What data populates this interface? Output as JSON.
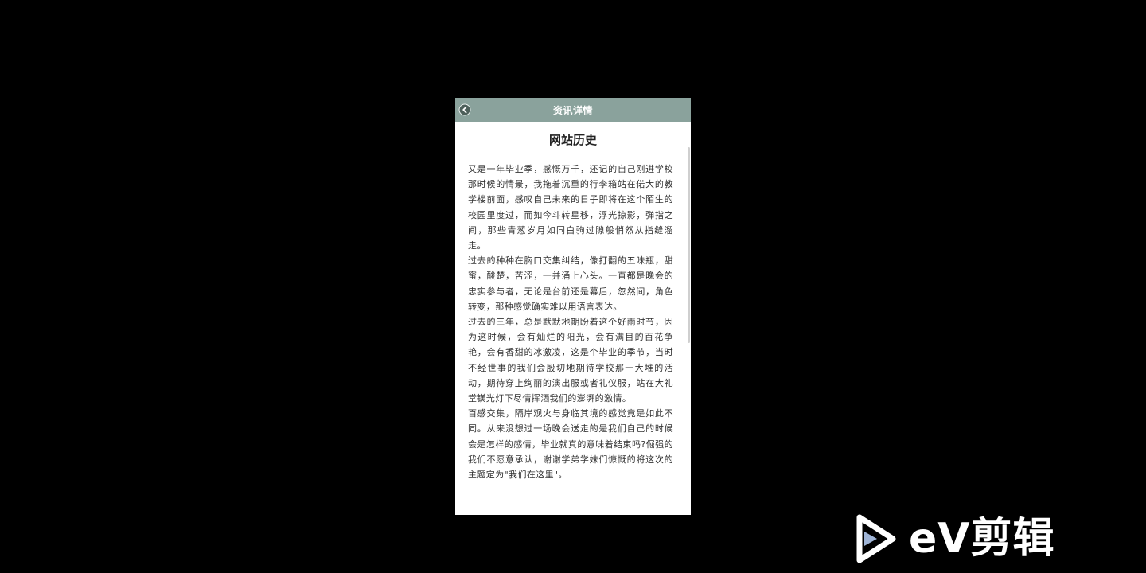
{
  "header": {
    "title": "资讯详情",
    "back_icon": "back-arrow-icon"
  },
  "article": {
    "title": "网站历史",
    "paragraphs": [
      "又是一年毕业季，感慨万千，还记的自己刚进学校那时候的情景，我拖着沉重的行李箱站在偌大的教学楼前面，感叹自己未来的日子即将在这个陌生的校园里度过，而如今斗转星移，浮光掠影，弹指之间，那些青葱岁月如同白驹过隙般悄然从指缝溜走。",
      "过去的种种在胸口交集纠结，像打翻的五味瓶，甜蜜，酸楚，苦涩，一并涌上心头。一直都是晚会的忠实参与者，无论是台前还是幕后，忽然间，角色转变，那种感觉确实难以用语言表达。",
      "过去的三年，总是默默地期盼着这个好雨时节，因为这时候，会有灿烂的阳光，会有满目的百花争艳，会有香甜的冰激凌，这是个毕业的季节，当时不经世事的我们会殷切地期待学校那一大堆的活动，期待穿上绚丽的演出服或者礼仪服，站在大礼堂镁光灯下尽情挥洒我们的澎湃的激情。",
      "百感交集，隔岸观火与身临其境的感觉竟是如此不同。从来没想过一场晚会送走的是我们自己的时候会是怎样的感情，毕业就真的意味着结束吗?倔强的我们不愿意承认，谢谢学弟学妹们慷慨的将这次的主题定为\"我们在这里\"。"
    ]
  },
  "watermark": {
    "text": "eV剪辑",
    "logo_icon": "ev-play-logo-icon"
  }
}
